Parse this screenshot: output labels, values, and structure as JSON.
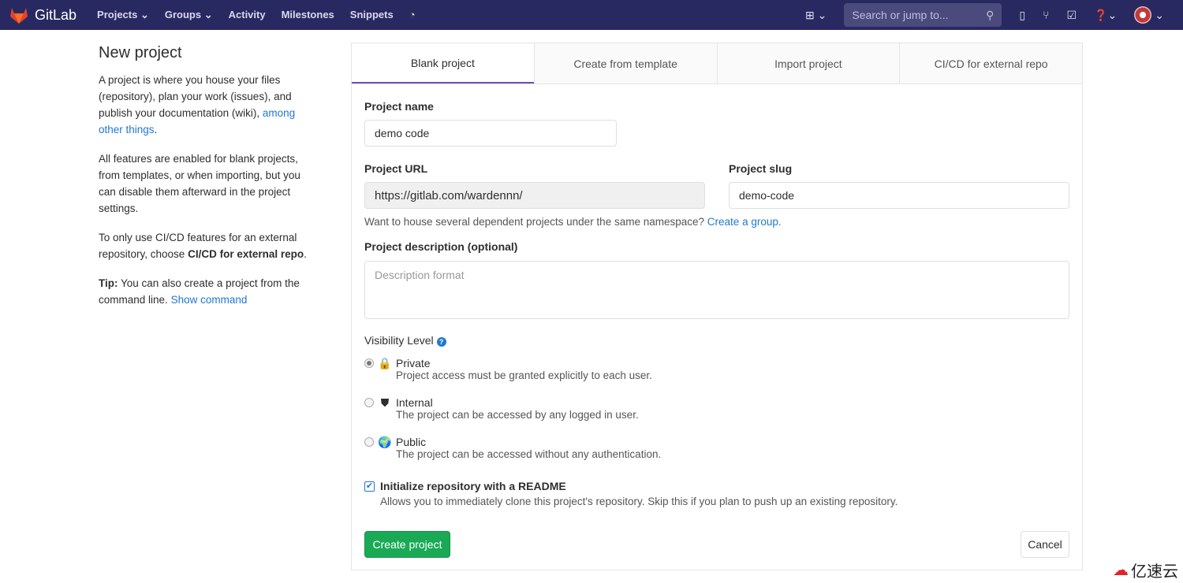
{
  "nav": {
    "brand": "GitLab",
    "links": [
      "Projects",
      "Groups",
      "Activity",
      "Milestones",
      "Snippets"
    ],
    "search_placeholder": "Search or jump to..."
  },
  "sidebar": {
    "title": "New project",
    "p1": "A project is where you house your files (repository), plan your work (issues), and publish your documentation (wiki),",
    "p1_link": "among other things",
    "p1_end": ".",
    "p2": "All features are enabled for blank projects, from templates, or when importing, but you can disable them afterward in the project settings.",
    "p3": "To only use CI/CD features for an external repository, choose",
    "p3_bold": "CI/CD for external repo",
    "p3_end": ".",
    "tip_label": "Tip:",
    "tip": "You can also create a project from the command line.",
    "tip_link": "Show command"
  },
  "tabs": [
    "Blank project",
    "Create from template",
    "Import project",
    "CI/CD for external repo"
  ],
  "form": {
    "name_label": "Project name",
    "name_value": "demo code",
    "url_label": "Project URL",
    "url_value": "https://gitlab.com/wardennn/",
    "slug_label": "Project slug",
    "slug_value": "demo-code",
    "group_hint": "Want to house several dependent projects under the same namespace?",
    "group_link": "Create a group.",
    "desc_label": "Project description (optional)",
    "desc_placeholder": "Description format",
    "visibility_label": "Visibility Level",
    "visibility": [
      {
        "name": "Private",
        "desc": "Project access must be granted explicitly to each user.",
        "selected": true,
        "icon": "lock"
      },
      {
        "name": "Internal",
        "desc": "The project can be accessed by any logged in user.",
        "selected": false,
        "icon": "shield"
      },
      {
        "name": "Public",
        "desc": "The project can be accessed without any authentication.",
        "selected": false,
        "icon": "globe"
      }
    ],
    "readme_label": "Initialize repository with a README",
    "readme_checked": true,
    "readme_desc": "Allows you to immediately clone this project's repository. Skip this if you plan to push up an existing repository.",
    "create": "Create project",
    "cancel": "Cancel"
  },
  "watermark": "亿速云"
}
